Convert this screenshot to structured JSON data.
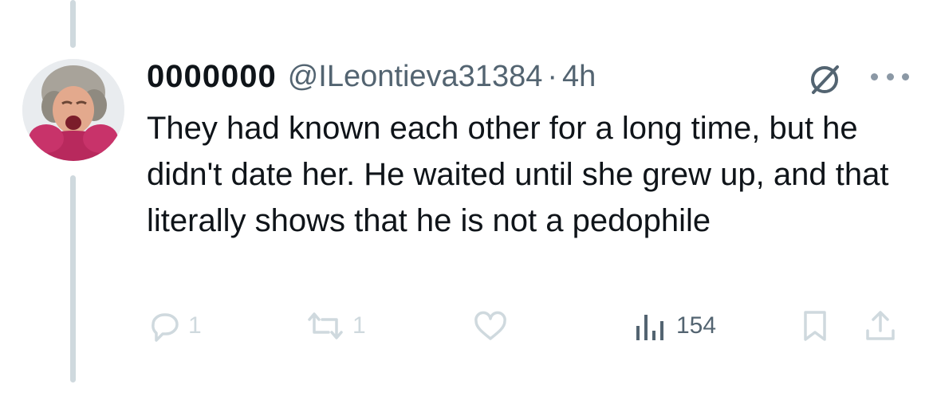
{
  "tweet": {
    "display_name": "0000000",
    "handle": "@ILeontieva31384",
    "separator": "·",
    "time": "4h",
    "text": "They had known each other for a long time, but he didn't date her. He waited until she grew up, and that literally shows that he is not a pedophile"
  },
  "actions": {
    "reply_count": "1",
    "retweet_count": "1",
    "like_count": "",
    "views_count": "154"
  },
  "icons": {
    "mute": "mute-icon",
    "more": "more-icon",
    "reply": "reply-icon",
    "retweet": "retweet-icon",
    "like": "heart-icon",
    "views": "views-icon",
    "bookmark": "bookmark-icon",
    "share": "share-icon"
  },
  "colors": {
    "text": "#0f1419",
    "secondary": "#536471",
    "faded_icon": "#cfd9de",
    "thread_line": "#cfd9de"
  }
}
